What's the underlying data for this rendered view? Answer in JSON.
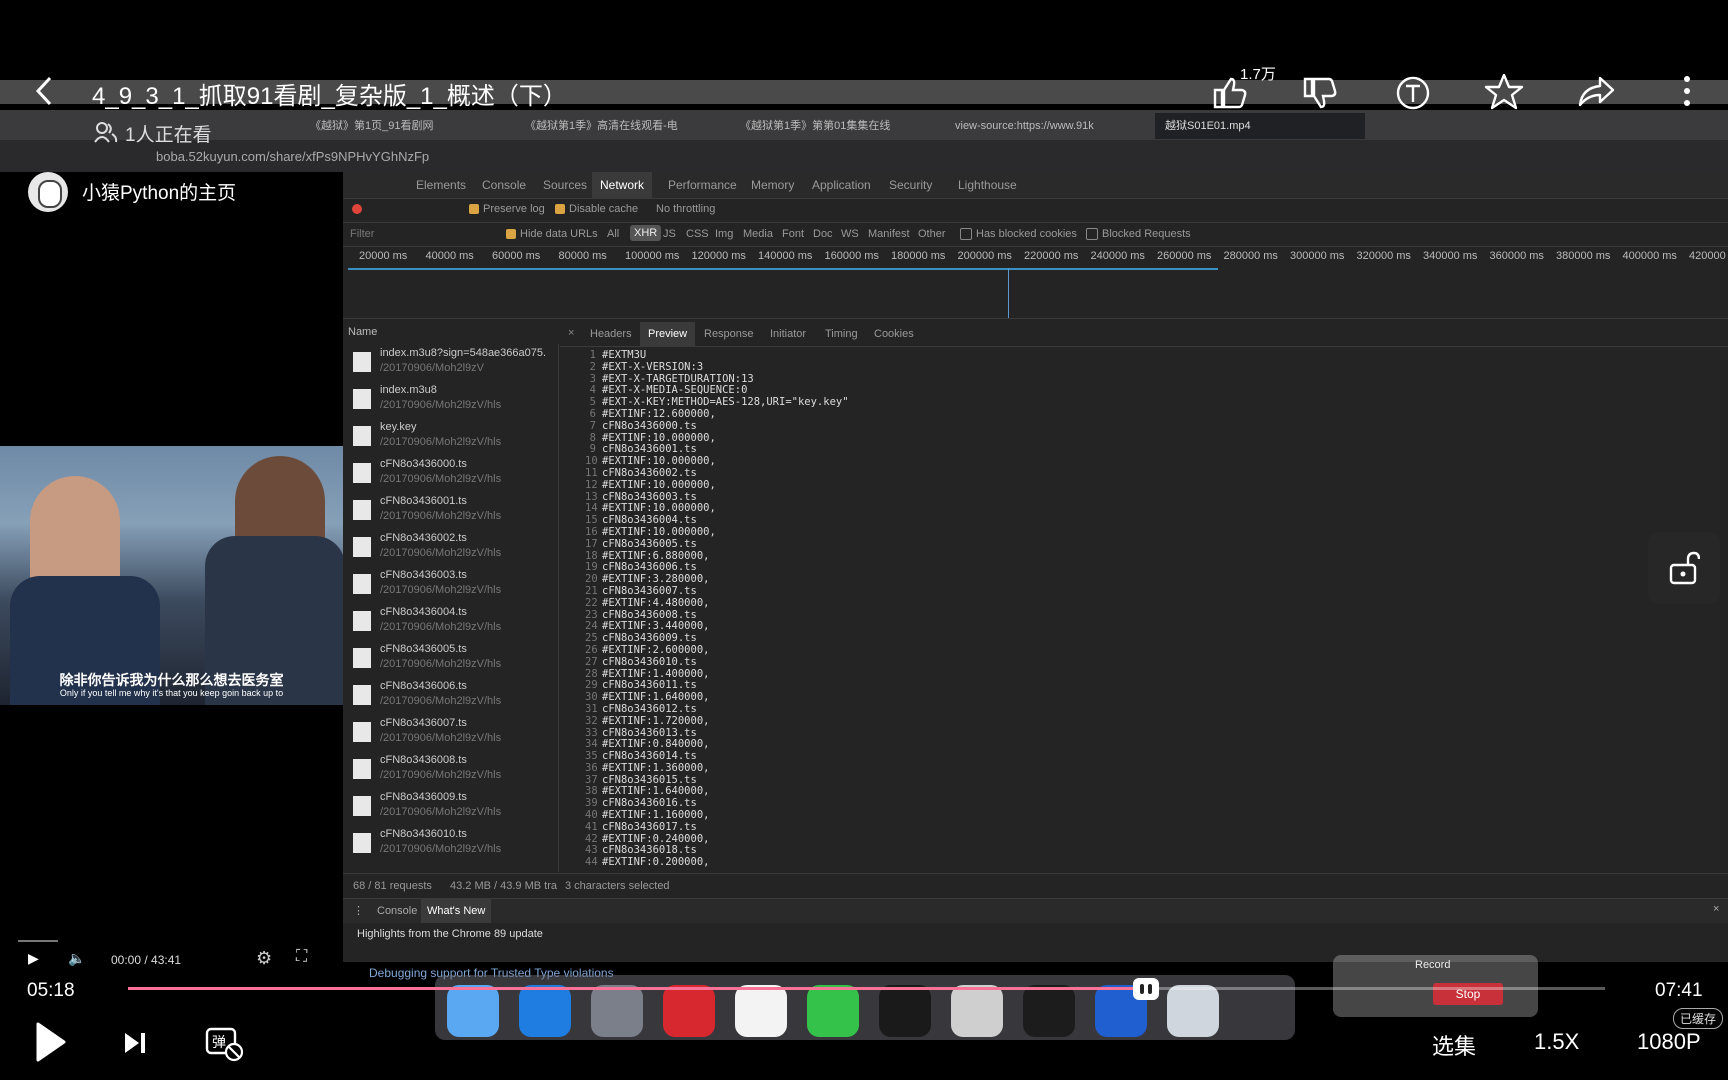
{
  "overlay": {
    "title": "4_9_3_1_抓取91看剧_复杂版_1_概述（下）",
    "watching": "1人正在看",
    "home_name": "小猿Python的主页",
    "like_count": "1.7万",
    "time_current": "05:18",
    "time_total": "07:41",
    "progress": 0.689,
    "select_episode": "选集",
    "speed": "1.5X",
    "quality": "1080P",
    "cached": "已缓存"
  },
  "browser": {
    "tabs": [
      {
        "label": "《越狱》第1页_91看剧网"
      },
      {
        "label": "《越狱第1季》高清在线观看-电"
      },
      {
        "label": "《越狱第1季》第第01集集在线"
      },
      {
        "label": "view-source:https://www.91k"
      },
      {
        "label": "越狱S01E01.mp4"
      }
    ],
    "url": "boba.52kuyun.com/share/xfPs9NPHvYGhNzFp"
  },
  "devtools": {
    "tabs": [
      "Elements",
      "Console",
      "Sources",
      "Network",
      "Performance",
      "Memory",
      "Application",
      "Security",
      "Lighthouse"
    ],
    "active_tab": "Network",
    "toolbar": {
      "preserve_log": "Preserve log",
      "disable_cache": "Disable cache",
      "throttling": "No throttling"
    },
    "filter": {
      "placeholder": "Filter",
      "hide_data_urls": "Hide data URLs",
      "types": [
        "All",
        "XHR",
        "JS",
        "CSS",
        "Img",
        "Media",
        "Font",
        "Doc",
        "WS",
        "Manifest",
        "Other"
      ],
      "active_type": "XHR",
      "blocked_cookies": "Has blocked cookies",
      "blocked_requests": "Blocked Requests"
    },
    "timeline_ticks": [
      "20000 ms",
      "40000 ms",
      "60000 ms",
      "80000 ms",
      "100000 ms",
      "120000 ms",
      "140000 ms",
      "160000 ms",
      "180000 ms",
      "200000 ms",
      "220000 ms",
      "240000 ms",
      "260000 ms",
      "280000 ms",
      "300000 ms",
      "320000 ms",
      "340000 ms",
      "360000 ms",
      "380000 ms",
      "400000 ms",
      "420000 ms"
    ],
    "name_header": "Name",
    "requests": [
      {
        "name": "index.m3u8?sign=548ae366a075.",
        "path": "/20170906/Moh2l9zV"
      },
      {
        "name": "index.m3u8",
        "path": "/20170906/Moh2l9zV/hls"
      },
      {
        "name": "key.key",
        "path": "/20170906/Moh2l9zV/hls"
      },
      {
        "name": "cFN8o3436000.ts",
        "path": "/20170906/Moh2l9zV/hls"
      },
      {
        "name": "cFN8o3436001.ts",
        "path": "/20170906/Moh2l9zV/hls"
      },
      {
        "name": "cFN8o3436002.ts",
        "path": "/20170906/Moh2l9zV/hls"
      },
      {
        "name": "cFN8o3436003.ts",
        "path": "/20170906/Moh2l9zV/hls"
      },
      {
        "name": "cFN8o3436004.ts",
        "path": "/20170906/Moh2l9zV/hls"
      },
      {
        "name": "cFN8o3436005.ts",
        "path": "/20170906/Moh2l9zV/hls"
      },
      {
        "name": "cFN8o3436006.ts",
        "path": "/20170906/Moh2l9zV/hls"
      },
      {
        "name": "cFN8o3436007.ts",
        "path": "/20170906/Moh2l9zV/hls"
      },
      {
        "name": "cFN8o3436008.ts",
        "path": "/20170906/Moh2l9zV/hls"
      },
      {
        "name": "cFN8o3436009.ts",
        "path": "/20170906/Moh2l9zV/hls"
      },
      {
        "name": "cFN8o3436010.ts",
        "path": "/20170906/Moh2l9zV/hls"
      }
    ],
    "detail_tabs": [
      "Headers",
      "Preview",
      "Response",
      "Initiator",
      "Timing",
      "Cookies"
    ],
    "active_detail_tab": "Preview",
    "preview_lines": [
      "#EXTM3U",
      "#EXT-X-VERSION:3",
      "#EXT-X-TARGETDURATION:13",
      "#EXT-X-MEDIA-SEQUENCE:0",
      "#EXT-X-KEY:METHOD=AES-128,URI=\"key.key\"",
      "#EXTINF:12.600000,",
      "cFN8o3436000.ts",
      "#EXTINF:10.000000,",
      "cFN8o3436001.ts",
      "#EXTINF:10.000000,",
      "cFN8o3436002.ts",
      "#EXTINF:10.000000,",
      "cFN8o3436003.ts",
      "#EXTINF:10.000000,",
      "cFN8o3436004.ts",
      "#EXTINF:10.000000,",
      "cFN8o3436005.ts",
      "#EXTINF:6.880000,",
      "cFN8o3436006.ts",
      "#EXTINF:3.280000,",
      "cFN8o3436007.ts",
      "#EXTINF:4.480000,",
      "cFN8o3436008.ts",
      "#EXTINF:3.440000,",
      "cFN8o3436009.ts",
      "#EXTINF:2.600000,",
      "cFN8o3436010.ts",
      "#EXTINF:1.400000,",
      "cFN8o3436011.ts",
      "#EXTINF:1.640000,",
      "cFN8o3436012.ts",
      "#EXTINF:1.720000,",
      "cFN8o3436013.ts",
      "#EXTINF:0.840000,",
      "cFN8o3436014.ts",
      "#EXTINF:1.360000,",
      "cFN8o3436015.ts",
      "#EXTINF:1.640000,",
      "cFN8o3436016.ts",
      "#EXTINF:1.160000,",
      "cFN8o3436017.ts",
      "#EXTINF:0.240000,",
      "cFN8o3436018.ts",
      "#EXTINF:0.200000,"
    ],
    "status": {
      "requests": "68 / 81 requests",
      "size": "43.2 MB / 43.9 MB tra",
      "selected": "3 characters selected"
    },
    "drawer_tabs": [
      "Console",
      "What's New"
    ],
    "drawer_text": "Highlights from the Chrome 89 update",
    "drawer_item": "Debugging support for Trusted Type violations"
  },
  "inner_player": {
    "time": "00:00 / 43:41"
  },
  "subtitles": {
    "cn": "除非你告诉我为什么那么想去医务室",
    "en": "Only if you tell me why it's that you keep goin back up to"
  },
  "record_window": {
    "title": "Record",
    "stop": "Stop"
  },
  "dock_icons": [
    "finder-icon",
    "safari-icon",
    "launchpad-icon",
    "netease-music-icon",
    "chrome-icon",
    "wechat-icon",
    "qq-icon",
    "typora-icon",
    "pycharm-icon",
    "thunder-icon",
    "trash-icon"
  ]
}
